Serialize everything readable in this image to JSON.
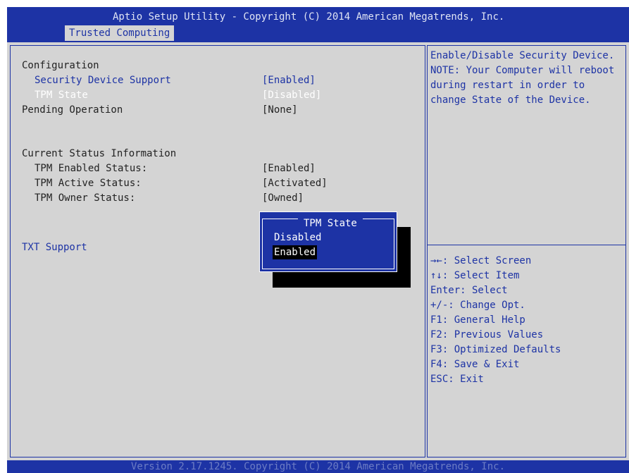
{
  "header": {
    "title": "Aptio Setup Utility - Copyright (C) 2014 American Megatrends, Inc.",
    "active_tab": "Trusted Computing"
  },
  "settings": {
    "configuration_heading": "Configuration",
    "security_device_support": {
      "label": "Security Device Support",
      "value": "[Enabled]"
    },
    "tpm_state": {
      "label": "TPM State",
      "value": "[Disabled]"
    },
    "pending_operation": {
      "label": "Pending Operation",
      "value": "[None]"
    },
    "status_heading": "Current Status Information",
    "tpm_enabled_status": {
      "label": "TPM Enabled Status:",
      "value": "[Enabled]"
    },
    "tpm_active_status": {
      "label": "TPM Active Status:",
      "value": "[Activated]"
    },
    "tpm_owner_status": {
      "label": "TPM Owner Status:",
      "value": "[Owned]"
    },
    "txt_support": {
      "label": "TXT Support"
    }
  },
  "popup": {
    "title": "TPM State",
    "options": [
      "Disabled",
      "Enabled"
    ],
    "selected": "Enabled"
  },
  "help": {
    "text": "Enable/Disable Security Device. NOTE: Your Computer will reboot during restart in order to change State of the Device.",
    "keys": [
      "→←: Select Screen",
      "↑↓: Select Item",
      "Enter: Select",
      "+/-: Change Opt.",
      "F1: General Help",
      "F2: Previous Values",
      "F3: Optimized Defaults",
      "F4: Save & Exit",
      "ESC: Exit"
    ]
  },
  "footer": {
    "text": "Version 2.17.1245. Copyright (C) 2014 American Megatrends, Inc."
  },
  "colors": {
    "bios_blue": "#1d33a5",
    "panel_gray": "#d4d4d4",
    "text_dark": "#222222",
    "highlight_white": "#ffffff"
  }
}
